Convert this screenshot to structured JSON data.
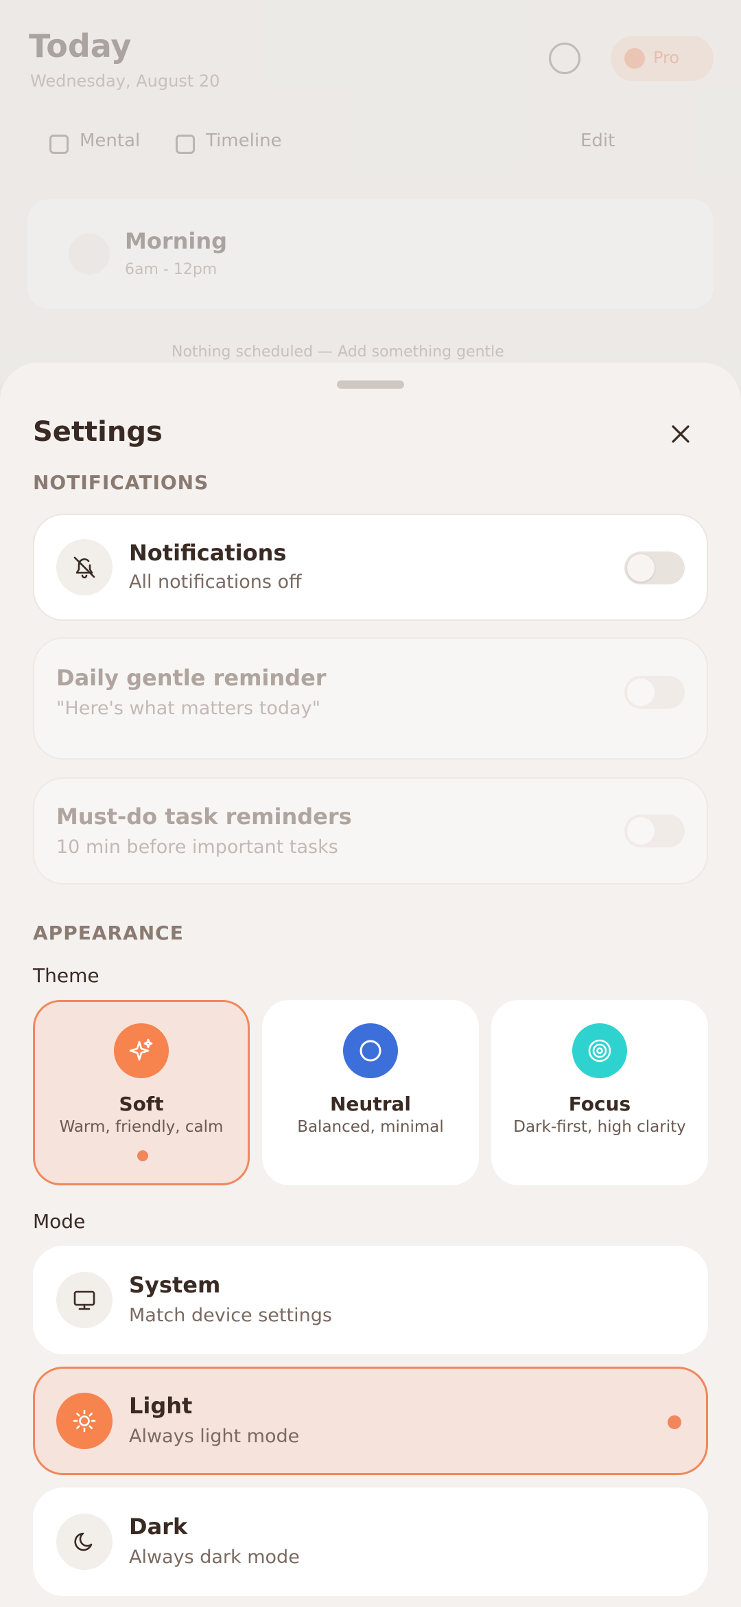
{
  "background": {
    "title": "Today",
    "date": "Wednesday, August 20",
    "pill_label": "Pro",
    "tabs": [
      "Mental",
      "Timeline",
      "Edit"
    ],
    "card_title": "Morning",
    "card_sub": "6am - 12pm",
    "footer": "Nothing scheduled — Add something gentle"
  },
  "sheet": {
    "title": "Settings",
    "sections": {
      "notifications": "NOTIFICATIONS",
      "appearance": "APPEARANCE"
    },
    "notifications": [
      {
        "title": "Notifications",
        "subtitle": "All notifications off",
        "enabled": false,
        "icon": "bell-off-icon"
      },
      {
        "title": "Daily gentle reminder",
        "subtitle": "\"Here's what matters today\"",
        "enabled": false
      },
      {
        "title": "Must-do task reminders",
        "subtitle": "10 min before important tasks",
        "enabled": false
      }
    ],
    "theme_label": "Theme",
    "themes": [
      {
        "name": "Soft",
        "desc": "Warm, friendly, calm",
        "color": "#f7834f",
        "icon": "sparkle-icon",
        "selected": true
      },
      {
        "name": "Neutral",
        "desc": "Balanced, minimal",
        "color": "#3d6fdb",
        "icon": "circle-icon",
        "selected": false
      },
      {
        "name": "Focus",
        "desc": "Dark-first, high clarity",
        "color": "#2ed3cf",
        "icon": "target-icon",
        "selected": false
      }
    ],
    "mode_label": "Mode",
    "modes": [
      {
        "title": "System",
        "subtitle": "Match device settings",
        "icon": "monitor-icon",
        "selected": false
      },
      {
        "title": "Light",
        "subtitle": "Always light mode",
        "icon": "sun-icon",
        "selected": true
      },
      {
        "title": "Dark",
        "subtitle": "Always dark mode",
        "icon": "moon-icon",
        "selected": false
      }
    ]
  },
  "colors": {
    "accent": "#f0875c",
    "selected_bg": "#f6e3db",
    "sheet_bg": "#f4f1ee"
  }
}
